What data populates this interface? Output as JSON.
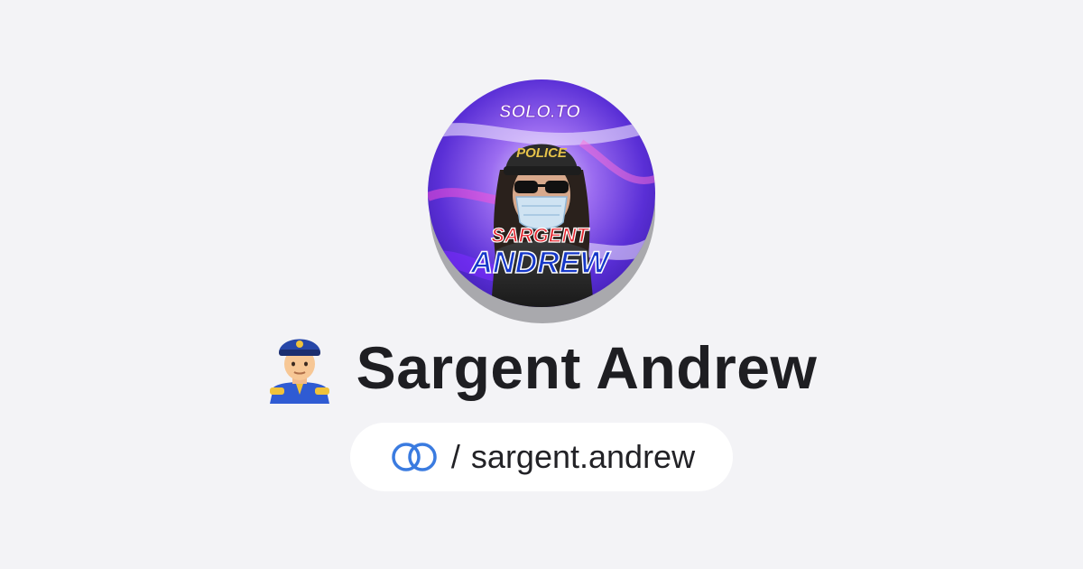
{
  "profile": {
    "display_name": "Sargent Andrew",
    "name_emoji": "police-officer-emoji",
    "handle_prefix": "/",
    "handle": "sargent.andrew",
    "avatar": {
      "brand_label": "SOLO.TO",
      "cap_label": "POLICE",
      "title_line_1": "SARGENT",
      "title_line_2": "ANDREW"
    }
  },
  "colors": {
    "background": "#f3f3f6",
    "text": "#1e1e22",
    "link_icon": "#3a7be0",
    "pill": "#ffffff"
  }
}
